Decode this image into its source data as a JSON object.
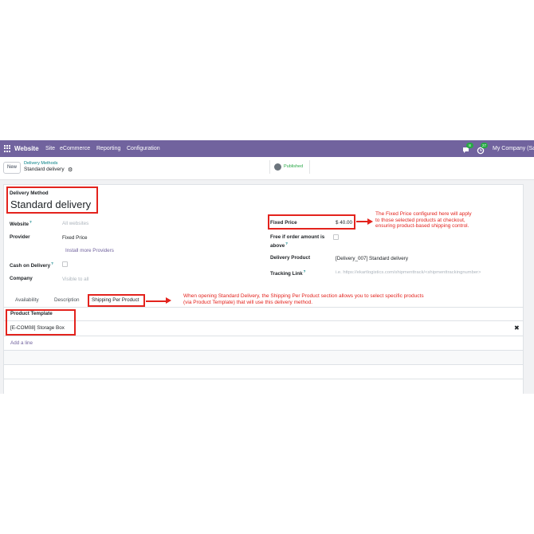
{
  "navbar": {
    "app_name": "Website",
    "menu": [
      "Site",
      "eCommerce",
      "Reporting",
      "Configuration"
    ],
    "chat_count": "8",
    "activity_count": "27",
    "company": "My Company (San Francisco)"
  },
  "control": {
    "new_label": "New",
    "breadcrumb_parent": "Delivery Methods",
    "breadcrumb_current": "Standard delivery",
    "published_label": "Published"
  },
  "form": {
    "delivery_method_label": "Delivery Method",
    "name": "Standard delivery",
    "website_label": "Website",
    "website_placeholder": "All websites",
    "provider_label": "Provider",
    "provider_value": "Fixed Price",
    "install_providers": "Install more Providers",
    "cash_label": "Cash on Delivery",
    "company_label": "Company",
    "company_placeholder": "Visible to all",
    "fixed_price_label": "Fixed Price",
    "fixed_price_value": "$ 40.00",
    "free_label_1": "Free if order amount is",
    "free_label_2": "above",
    "delivery_product_label": "Delivery Product",
    "delivery_product_value": "[Delivery_007] Standard delivery",
    "tracking_label": "Tracking Link",
    "tracking_placeholder": "i.e. https://ekartlogistics.com/shipmenttrack/<shipmenttrackingnumber>"
  },
  "tabs": [
    "Availability",
    "Description",
    "Shipping Per Product"
  ],
  "table": {
    "header": "Product Template",
    "rows": [
      "[E-COM08] Storage Box"
    ],
    "add_line": "Add a line"
  },
  "annotations": {
    "price_note": [
      "The Fixed Price configured here will apply",
      "to those selected products at checkout,",
      "ensuring product-based shipping control."
    ],
    "tab_note": [
      "When opening Standard Delivery, the Shipping Per Product section allows you to select specific products",
      "(via Product Template) that will use this delivery method."
    ],
    "color": "#e3231d"
  },
  "theme": {
    "navbar_bg": "#71639e",
    "link_color": "#71639e",
    "accent_teal": "#017e84",
    "published_green": "#28a745"
  },
  "icons": {
    "apps": "grid-icon",
    "chat": "chat-icon",
    "activity": "clock-icon",
    "settings": "gear-icon",
    "status": "globe-icon",
    "delete": "close-icon"
  }
}
